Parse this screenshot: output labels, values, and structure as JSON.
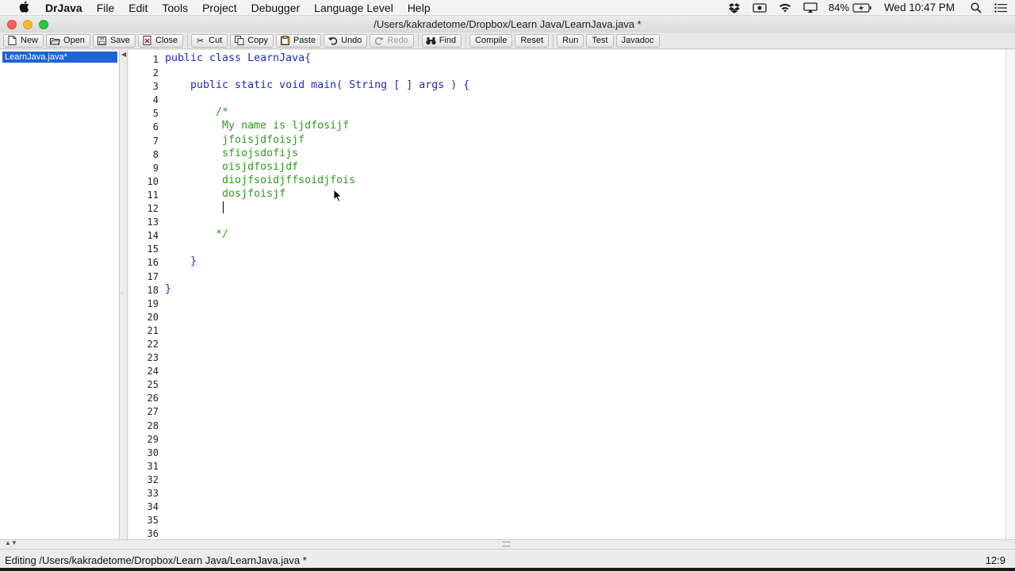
{
  "menubar": {
    "app_name": "DrJava",
    "items": [
      {
        "label": "File"
      },
      {
        "label": "Edit"
      },
      {
        "label": "Tools"
      },
      {
        "label": "Project"
      },
      {
        "label": "Debugger"
      },
      {
        "label": "Language Level"
      },
      {
        "label": "Help"
      }
    ],
    "status": {
      "battery": "84%",
      "clock": "Wed 10:47 PM"
    }
  },
  "window": {
    "title": "/Users/kakradetome/Dropbox/Learn Java/LearnJava.java *"
  },
  "toolbar": {
    "new_label": "New",
    "open_label": "Open",
    "save_label": "Save",
    "close_label": "Close",
    "cut_label": "Cut",
    "copy_label": "Copy",
    "paste_label": "Paste",
    "undo_label": "Undo",
    "redo_label": "Redo",
    "find_label": "Find",
    "compile_label": "Compile",
    "reset_label": "Reset",
    "run_label": "Run",
    "test_label": "Test",
    "javadoc_label": "Javadoc"
  },
  "files": [
    {
      "name": "LearnJava.java*",
      "selected": true
    }
  ],
  "editor": {
    "line_numbers": [
      "1",
      "2",
      "3",
      "4",
      "5",
      "6",
      "7",
      "8",
      "9",
      "10",
      "11",
      "12",
      "13",
      "14",
      "15",
      "16",
      "17",
      "18",
      "19",
      "20",
      "21",
      "22",
      "23",
      "24",
      "25",
      "26",
      "27",
      "28",
      "29",
      "30",
      "31",
      "32",
      "33",
      "34",
      "35",
      "36"
    ],
    "lines": [
      {
        "text": "public class LearnJava{",
        "kind": "code"
      },
      {
        "text": "",
        "kind": "code"
      },
      {
        "text": "    public static void main( String [ ] args ) {",
        "kind": "code"
      },
      {
        "text": "",
        "kind": "code"
      },
      {
        "text": "        /*",
        "kind": "comment"
      },
      {
        "text": "         My name is ljdfosijf",
        "kind": "comment"
      },
      {
        "text": "         jfoisjdfoisjf",
        "kind": "comment"
      },
      {
        "text": "         sfiojsdofijs",
        "kind": "comment"
      },
      {
        "text": "         oisjdfosijdf",
        "kind": "comment"
      },
      {
        "text": "         diojfsoidjffsoidjfois",
        "kind": "comment"
      },
      {
        "text": "         dosjfoisjf",
        "kind": "comment"
      },
      {
        "text": "         ",
        "kind": "comment"
      },
      {
        "text": "",
        "kind": "comment"
      },
      {
        "text": "        */",
        "kind": "comment"
      },
      {
        "text": "",
        "kind": "code"
      },
      {
        "text": "    }",
        "kind": "code"
      },
      {
        "text": "",
        "kind": "code"
      },
      {
        "text": "}",
        "kind": "code"
      }
    ],
    "colors": {
      "keyword": "#1d2cb8",
      "comment": "#2f9a1e"
    }
  },
  "statusbar": {
    "message": "Editing /Users/kakradetome/Dropbox/Learn Java/LearnJava.java *",
    "position": "12:9"
  }
}
